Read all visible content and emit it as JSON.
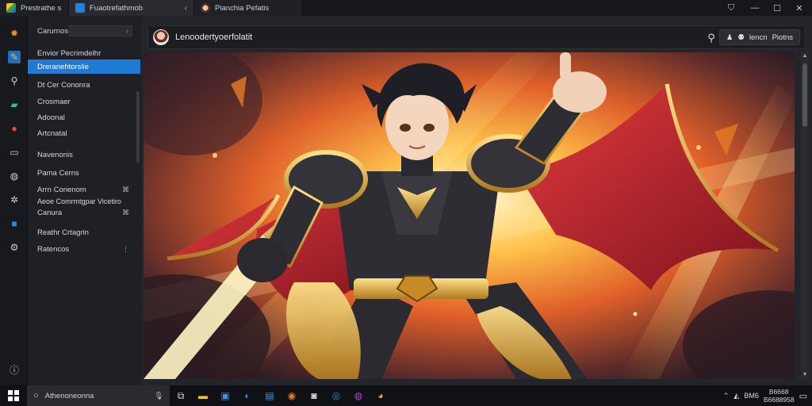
{
  "tabs": [
    {
      "label": "Prestrathe s"
    },
    {
      "label": "Fuaotrefathmob"
    },
    {
      "label": "Pianchia Pefatis"
    }
  ],
  "window_controls": {
    "minimize": "—",
    "maximize": "☐",
    "close": "✕"
  },
  "nav": {
    "search_label": "Carurnos",
    "search_chevron": "›",
    "items": [
      {
        "label": "Envior Pecrimdelhr",
        "badge": ""
      },
      {
        "label": "Dreranehtorslie",
        "badge": ""
      },
      {
        "label": "Dt Cer Cononra",
        "badge": ""
      },
      {
        "label": "Crosmaer",
        "badge": ""
      },
      {
        "label": "Adoonal",
        "badge": ""
      },
      {
        "label": "Artcnatal",
        "badge": ""
      },
      {
        "label": "Navenonis",
        "badge": ""
      },
      {
        "label": "Pama Cerns",
        "badge": ""
      },
      {
        "label": "Arrn Conenom",
        "badge": "⌘"
      },
      {
        "label": "Aeoe Comrmtgpar Vicetiro",
        "badge": ""
      },
      {
        "label": "Canura",
        "badge": "⌘"
      },
      {
        "label": "Reathr Crtagrin",
        "badge": ""
      },
      {
        "label": "Ratencos",
        "badge": "⋮"
      }
    ]
  },
  "main": {
    "title": "Lenoodertyoerfolatit",
    "actions": {
      "icon_a": "♟",
      "icon_b": "⚉",
      "label_a": "lencn",
      "label_b": "Piotns"
    }
  },
  "taskbar": {
    "search_placeholder": "Athenoneonna",
    "clock_time": "B6668",
    "clock_date": "B6688958",
    "tray_label": "BM6"
  },
  "colors": {
    "accent": "#1f7ad6",
    "background": "#1f2025"
  }
}
